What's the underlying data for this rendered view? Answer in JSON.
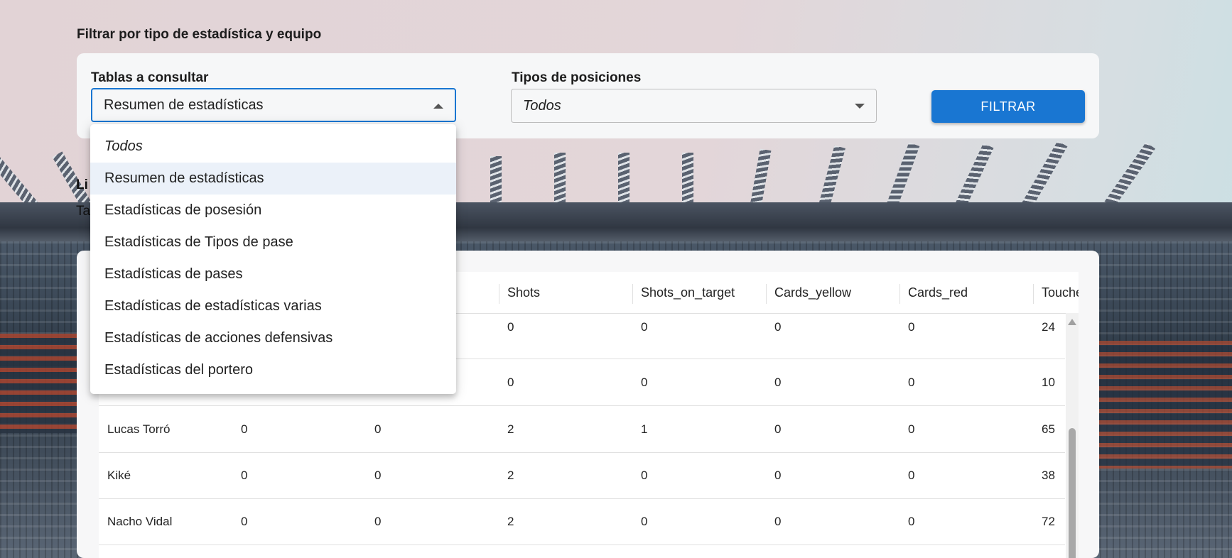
{
  "filter": {
    "title": "Filtrar por tipo de estadística y equipo",
    "tables_label": "Tablas a consultar",
    "tables_value": "Resumen de estadísticas",
    "positions_label": "Tipos de posiciones",
    "positions_value": "Todos",
    "button_label": "FILTRAR"
  },
  "partial_text": {
    "heading": "Li",
    "subtext": "Ta"
  },
  "dropdown": {
    "options": [
      "Todos",
      "Resumen de estadísticas",
      "Estadísticas de posesión",
      "Estadísticas de Tipos de pase",
      "Estadísticas de pases",
      "Estadísticas de estadísticas varias",
      "Estadísticas de acciones defensivas",
      "Estadísticas del portero"
    ],
    "selected_index": 1
  },
  "table": {
    "columns": [
      "Shots",
      "Shots_on_target",
      "Cards_yellow",
      "Cards_red",
      "Touche"
    ],
    "rows": [
      {
        "name": "",
        "c1": "",
        "c2": "",
        "shots": "0",
        "shots_on_target": "0",
        "cards_yellow": "0",
        "cards_red": "0",
        "touches": "24"
      },
      {
        "name": "",
        "c1": "",
        "c2": "",
        "shots": "0",
        "shots_on_target": "0",
        "cards_yellow": "0",
        "cards_red": "0",
        "touches": "10"
      },
      {
        "name": "Lucas Torró",
        "c1": "0",
        "c2": "0",
        "shots": "2",
        "shots_on_target": "1",
        "cards_yellow": "0",
        "cards_red": "0",
        "touches": "65"
      },
      {
        "name": "Kiké",
        "c1": "0",
        "c2": "0",
        "shots": "2",
        "shots_on_target": "0",
        "cards_yellow": "0",
        "cards_red": "0",
        "touches": "38"
      },
      {
        "name": "Nacho Vidal",
        "c1": "0",
        "c2": "0",
        "shots": "2",
        "shots_on_target": "0",
        "cards_yellow": "0",
        "cards_red": "0",
        "touches": "72"
      }
    ]
  },
  "colors": {
    "accent": "#1976d2",
    "selected_option": "#ebf1f9"
  }
}
